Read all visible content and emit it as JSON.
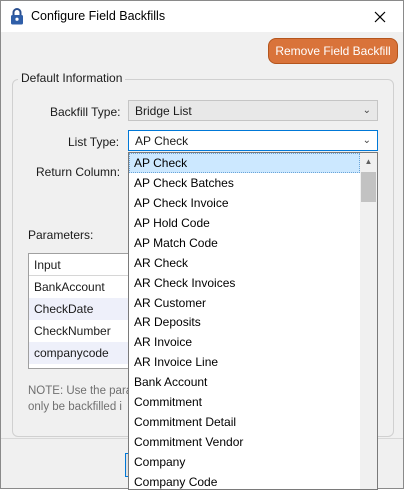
{
  "window": {
    "title": "Configure Field Backfills"
  },
  "toolbar": {
    "remove_label": "Remove Field Backfill"
  },
  "group": {
    "legend": "Default Information"
  },
  "form": {
    "backfill_type_label": "Backfill Type:",
    "backfill_type_value": "Bridge List",
    "list_type_label": "List Type:",
    "list_type_value": "AP Check",
    "return_column_label": "Return Column:",
    "parameters_label": "Parameters:"
  },
  "grid": {
    "header": "Input",
    "rows": [
      "BankAccount",
      "CheckDate",
      "CheckNumber",
      "companycode"
    ]
  },
  "note": {
    "line1": "NOTE: Use the para",
    "line2": "only be backfilled i"
  },
  "dropdown": {
    "items": [
      "AP Check",
      "AP Check Batches",
      "AP Check Invoice",
      "AP Hold Code",
      "AP Match Code",
      "AR Check",
      "AR Check Invoices",
      "AR Customer",
      "AR Deposits",
      "AR Invoice",
      "AR Invoice Line",
      "Bank Account",
      "Commitment",
      "Commitment Detail",
      "Commitment Vendor",
      "Company",
      "Company Code"
    ],
    "selected": "AP Check"
  },
  "colors": {
    "accent": "#d9733a",
    "focus": "#0078d7",
    "selection": "#cce8ff"
  },
  "icons": {
    "title": "lock-icon",
    "close": "close-icon",
    "combo_arrow": "chevron-down-icon"
  }
}
